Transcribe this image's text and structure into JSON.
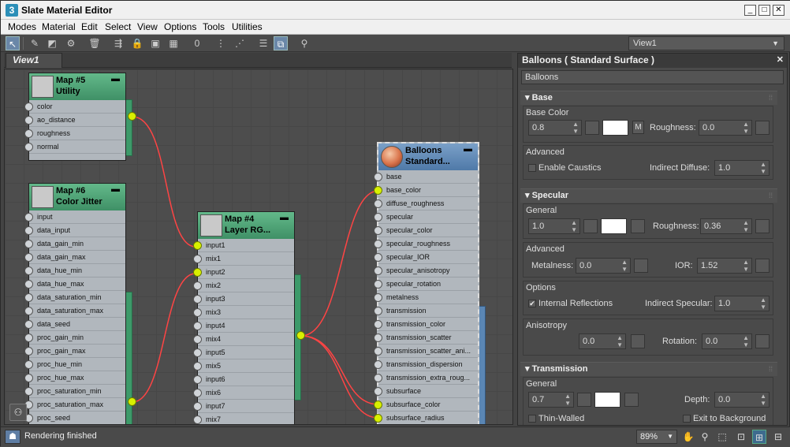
{
  "window": {
    "title": "Slate Material Editor",
    "app_icon": "3"
  },
  "menu": [
    "Modes",
    "Material",
    "Edit",
    "Select",
    "View",
    "Options",
    "Tools",
    "Utilities"
  ],
  "toolbar": {
    "view_select": "View1"
  },
  "view_tab": "View1",
  "nodes": {
    "map5": {
      "line1": "Map #5",
      "line2": "Utility",
      "slots": [
        "color",
        "ao_distance",
        "roughness",
        "normal"
      ]
    },
    "map6": {
      "line1": "Map #6",
      "line2": "Color Jitter",
      "slots": [
        "input",
        "data_input",
        "data_gain_min",
        "data_gain_max",
        "data_hue_min",
        "data_hue_max",
        "data_saturation_min",
        "data_saturation_max",
        "data_seed",
        "proc_gain_min",
        "proc_gain_max",
        "proc_hue_min",
        "proc_hue_max",
        "proc_saturation_min",
        "proc_saturation_max",
        "proc_seed"
      ]
    },
    "map4": {
      "line1": "Map #4",
      "line2": "Layer RG...",
      "slots": [
        "input1",
        "mix1",
        "input2",
        "mix2",
        "input3",
        "mix3",
        "input4",
        "mix4",
        "input5",
        "mix5",
        "input6",
        "mix6",
        "input7",
        "mix7"
      ]
    },
    "balloons": {
      "line1": "Balloons",
      "line2": "Standard...",
      "slots": [
        "base",
        "base_color",
        "diffuse_roughness",
        "specular",
        "specular_color",
        "specular_roughness",
        "specular_IOR",
        "specular_anisotropy",
        "specular_rotation",
        "metalness",
        "transmission",
        "transmission_color",
        "transmission_scatter",
        "transmission_scatter_ani...",
        "transmission_dispersion",
        "transmission_extra_roug...",
        "subsurface",
        "subsurface_color",
        "subsurface_radius"
      ]
    }
  },
  "panel": {
    "title": "Balloons  ( Standard Surface )",
    "name": "Balloons",
    "base": {
      "header": "Base",
      "group_label": "Base Color",
      "weight": "0.8",
      "m_label": "M",
      "roughness_label": "Roughness:",
      "roughness": "0.0",
      "advanced_label": "Advanced",
      "caustics_label": "Enable Caustics",
      "indirect_diffuse_label": "Indirect Diffuse:",
      "indirect_diffuse": "1.0"
    },
    "specular": {
      "header": "Specular",
      "general_label": "General",
      "weight": "1.0",
      "roughness_label": "Roughness:",
      "roughness": "0.36",
      "advanced_label": "Advanced",
      "metalness_label": "Metalness:",
      "metalness": "0.0",
      "ior_label": "IOR:",
      "ior": "1.52",
      "options_label": "Options",
      "internal_reflections_label": "Internal Reflections",
      "internal_reflections_checked": true,
      "indirect_specular_label": "Indirect Specular:",
      "indirect_specular": "1.0",
      "anisotropy_label": "Anisotropy",
      "anisotropy": "0.0",
      "rotation_label": "Rotation:",
      "rotation": "0.0"
    },
    "transmission": {
      "header": "Transmission",
      "general_label": "General",
      "weight": "0.7",
      "depth_label": "Depth:",
      "depth": "0.0",
      "thin_walled_label": "Thin-Walled",
      "exit_to_background_label": "Exit to Background"
    }
  },
  "status": {
    "text": "Rendering finished",
    "zoom": "89%"
  },
  "colors": {
    "node_green": "#4fa676",
    "node_blue": "#6189b6",
    "wire": "#ff4040",
    "connector": "#d8f000"
  }
}
